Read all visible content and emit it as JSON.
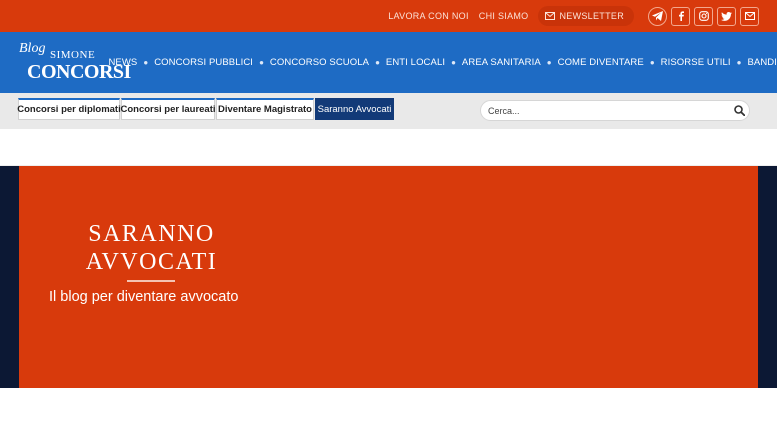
{
  "topbar": {
    "links": [
      "LAVORA CON NOI",
      "CHI SIAMO"
    ],
    "newsletter_label": "NEWSLETTER",
    "social": [
      "telegram-icon",
      "facebook-icon",
      "instagram-icon",
      "twitter-icon",
      "mail-icon"
    ]
  },
  "logo": {
    "blog": "Blog",
    "simone": "SIMONE",
    "concorsi": "CONCORSI"
  },
  "nav": {
    "items": [
      "NEWS",
      "CONCORSI PUBBLICI",
      "CONCORSO SCUOLA",
      "ENTI LOCALI",
      "AREA SANITARIA",
      "COME DIVENTARE",
      "RISORSE UTILI",
      "BANDI"
    ]
  },
  "subnav": {
    "tabs": [
      "Concorsi per diplomati",
      "Concorsi per laureati",
      "Diventare Magistrato",
      "Saranno Avvocati"
    ],
    "active_tab": "Saranno Avvocati"
  },
  "search": {
    "placeholder": "Cerca..."
  },
  "hero": {
    "title_line1": "SARANNO",
    "title_line2": "AVVOCATI",
    "subtitle": "Il blog per diventare avvocato"
  },
  "colors": {
    "accent_orange": "#d83a0c",
    "nav_blue": "#1e6bc4",
    "dark_navy": "#123a78",
    "hero_side": "#0c1834"
  }
}
